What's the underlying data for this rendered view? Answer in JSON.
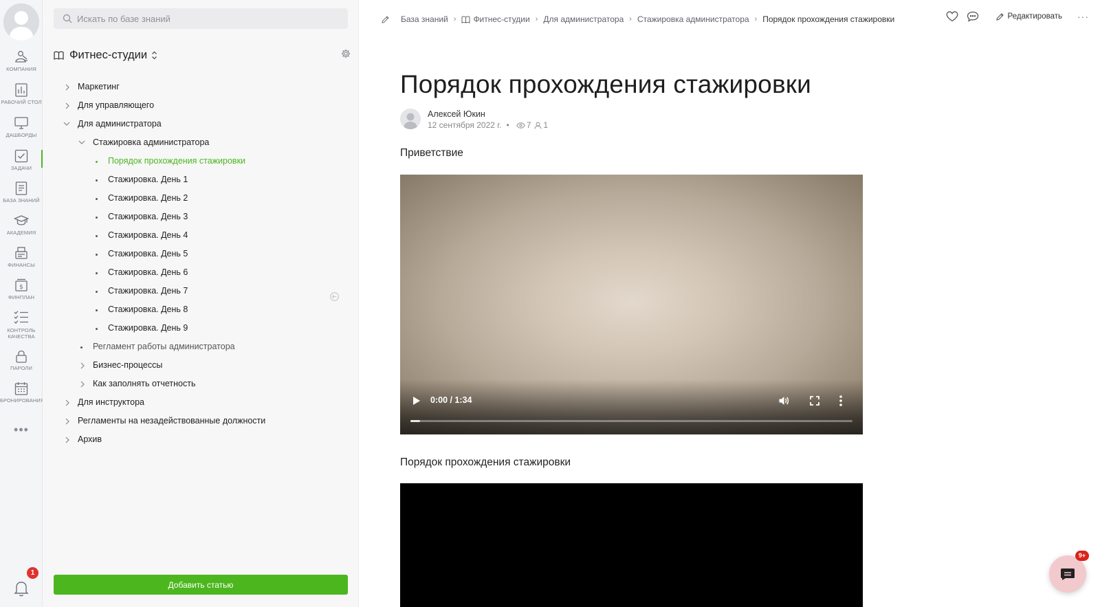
{
  "rail": {
    "items": [
      {
        "label": "Компания",
        "icon": "company-icon"
      },
      {
        "label": "Рабочий стол",
        "icon": "desktop-chart-icon"
      },
      {
        "label": "Дашборды",
        "icon": "monitor-icon"
      },
      {
        "label": "Задачи",
        "icon": "checkbox-icon"
      },
      {
        "label": "База знаний",
        "icon": "document-icon"
      },
      {
        "label": "Академия",
        "icon": "graduation-cap-icon"
      },
      {
        "label": "Финансы",
        "icon": "cash-register-icon"
      },
      {
        "label": "Финплан",
        "icon": "money-plan-icon"
      },
      {
        "label": "Контроль качества",
        "icon": "checklist-icon"
      },
      {
        "label": "Пароли",
        "icon": "lock-icon"
      },
      {
        "label": "Бронирования",
        "icon": "calendar-icon"
      }
    ],
    "more": "•••",
    "notifications_count": "1"
  },
  "panel": {
    "search_placeholder": "Искать по базе знаний",
    "kb_title": "Фитнес-студии",
    "tree": [
      {
        "label": "Маркетинг"
      },
      {
        "label": "Для управляющего"
      },
      {
        "label": "Для администратора"
      },
      {
        "label": "Стажировка администратора"
      },
      {
        "label": "Порядок прохождения стажировки"
      },
      {
        "label": "Стажировка. День 1"
      },
      {
        "label": "Стажировка. День 2"
      },
      {
        "label": "Стажировка. День 3"
      },
      {
        "label": "Стажировка. День 4"
      },
      {
        "label": "Стажировка. День 5"
      },
      {
        "label": "Стажировка. День 6"
      },
      {
        "label": "Стажировка. День 7"
      },
      {
        "label": "Стажировка. День 8"
      },
      {
        "label": "Стажировка. День 9"
      },
      {
        "label": "Регламент работы администратора"
      },
      {
        "label": "Бизнес-процессы"
      },
      {
        "label": "Как заполнять отчетность"
      },
      {
        "label": "Для инструктора"
      },
      {
        "label": "Регламенты на незадействованные должности"
      },
      {
        "label": "Архив"
      }
    ],
    "add_button": "Добавить статью"
  },
  "breadcrumbs": [
    "База знаний",
    "Фитнес-студии",
    "Для администратора",
    "Стажировка администратора",
    "Порядок прохождения стажировки"
  ],
  "actions": {
    "edit_label": "Редактировать",
    "more": "···"
  },
  "article": {
    "title": "Порядок прохождения стажировки",
    "author": "Алексей Юкин",
    "date": "12 сентября 2022 г.",
    "views": "7",
    "readers": "1",
    "section1": "Приветствие",
    "video1_time": "0:00 / 1:34",
    "video1_progress": 0.02,
    "section2": "Порядок прохождения стажировки"
  },
  "chat": {
    "badge": "9+"
  },
  "colors": {
    "accent": "#4cb61e",
    "badge": "#e0332f"
  }
}
